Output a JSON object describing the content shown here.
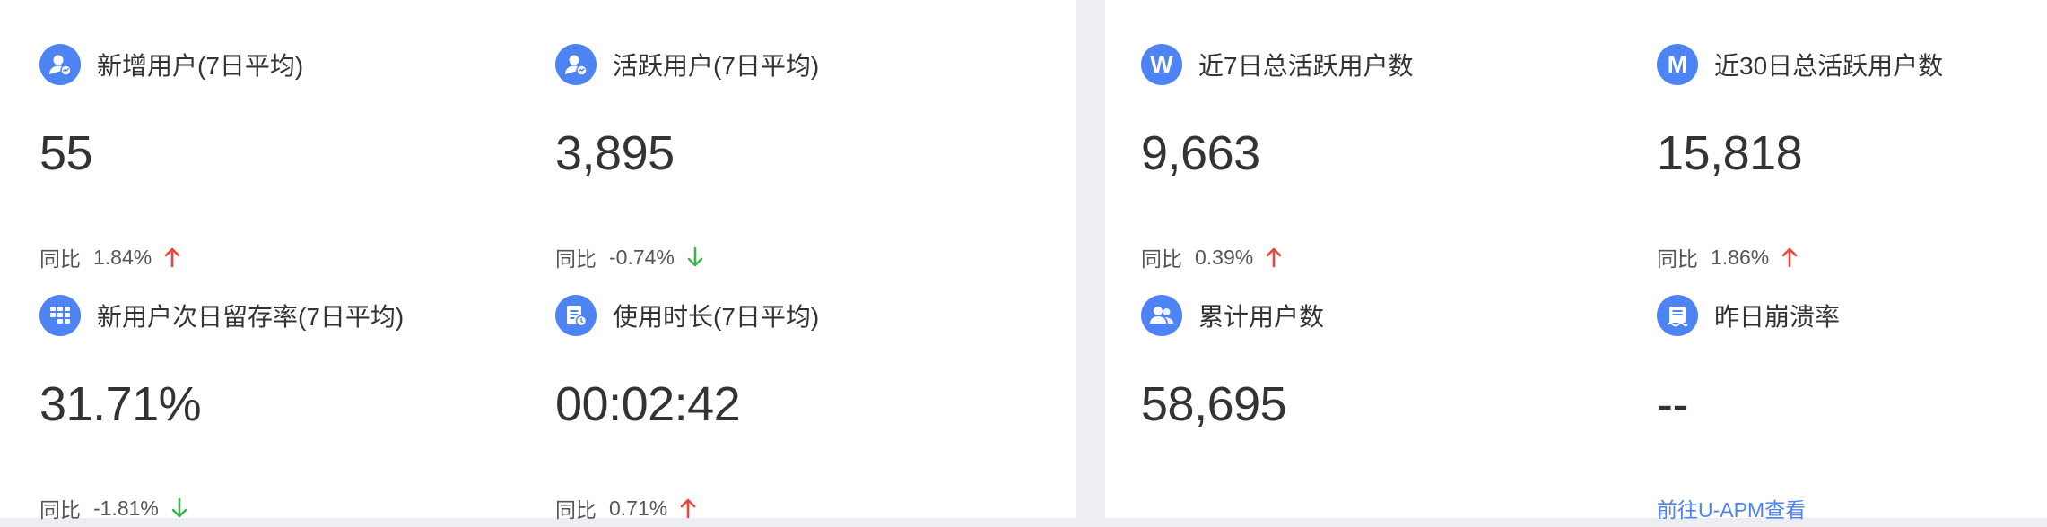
{
  "colors": {
    "accent": "#4e83f4",
    "up": "#e8453c",
    "down": "#3fb34f",
    "background": "#eceef2",
    "card": "#ffffff"
  },
  "metrics_left": [
    {
      "icon": "user-stats-icon",
      "title": "新增用户(7日平均)",
      "value": "55",
      "cmp_label": "同比",
      "cmp_value": "1.84%",
      "trend": "up"
    },
    {
      "icon": "user-stats-icon",
      "title": "活跃用户(7日平均)",
      "value": "3,895",
      "cmp_label": "同比",
      "cmp_value": "-0.74%",
      "trend": "down"
    },
    {
      "icon": "grid-retention-icon",
      "title": "新用户次日留存率(7日平均)",
      "value": "31.71%",
      "cmp_label": "同比",
      "cmp_value": "-1.81%",
      "trend": "down"
    },
    {
      "icon": "document-clock-icon",
      "title": "使用时长(7日平均)",
      "value": "00:02:42",
      "cmp_label": "同比",
      "cmp_value": "0.71%",
      "trend": "up"
    }
  ],
  "metrics_right": [
    {
      "icon": "letter-w-icon",
      "icon_letter": "W",
      "title": "近7日总活跃用户数",
      "value": "9,663",
      "cmp_label": "同比",
      "cmp_value": "0.39%",
      "trend": "up"
    },
    {
      "icon": "letter-m-icon",
      "icon_letter": "M",
      "title": "近30日总活跃用户数",
      "value": "15,818",
      "cmp_label": "同比",
      "cmp_value": "1.86%",
      "trend": "up"
    },
    {
      "icon": "users-icon",
      "title": "累计用户数",
      "value": "58,695"
    },
    {
      "icon": "crash-report-icon",
      "title": "昨日崩溃率",
      "value": "--",
      "link": "前往U-APM查看"
    }
  ]
}
